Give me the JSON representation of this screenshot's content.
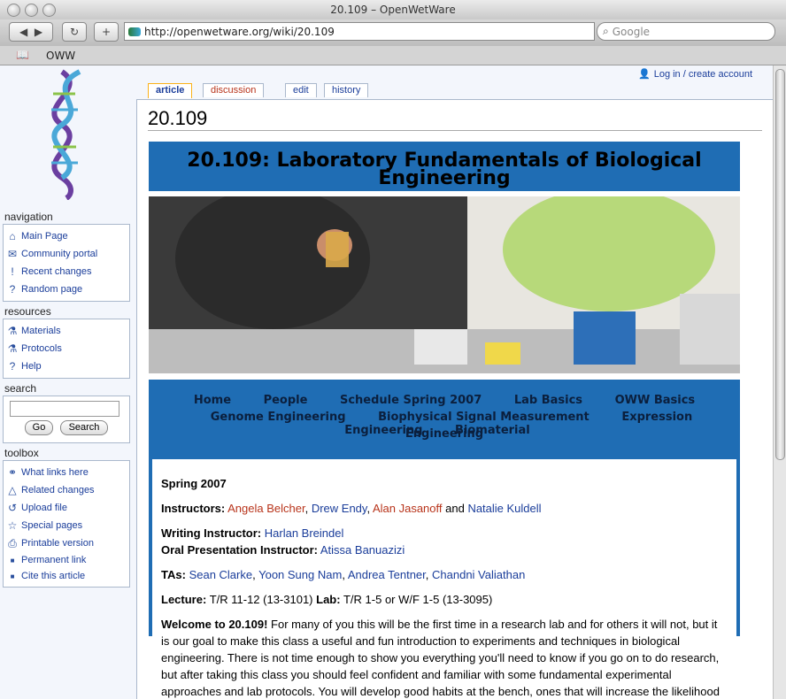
{
  "window": {
    "title": "20.109 – OpenWetWare"
  },
  "browser": {
    "url": "http://openwetware.org/wiki/20.109",
    "search_placeholder": "Google",
    "bookmarks": [
      "OWW"
    ]
  },
  "user_links": {
    "login": "Log in / create account"
  },
  "tabs": [
    "article",
    "discussion",
    "edit",
    "history"
  ],
  "sidebar": {
    "navigation_title": "navigation",
    "navigation": [
      {
        "label": "Main Page",
        "icon": "house-icon"
      },
      {
        "label": "Community portal",
        "icon": "chat-icon"
      },
      {
        "label": "Recent changes",
        "icon": "exclamation-icon"
      },
      {
        "label": "Random page",
        "icon": "question-icon"
      }
    ],
    "resources_title": "resources",
    "resources": [
      {
        "label": "Materials",
        "icon": "flask-icon"
      },
      {
        "label": "Protocols",
        "icon": "beaker-icon"
      },
      {
        "label": "Help",
        "icon": "question-icon"
      }
    ],
    "search_title": "search",
    "search_go": "Go",
    "search_button": "Search",
    "toolbox_title": "toolbox",
    "toolbox": [
      {
        "label": "What links here",
        "icon": "link-icon"
      },
      {
        "label": "Related changes",
        "icon": "triangle-icon"
      },
      {
        "label": "Upload file",
        "icon": "upload-icon"
      },
      {
        "label": "Special pages",
        "icon": "star-icon"
      },
      {
        "label": "Printable version",
        "icon": "printer-icon"
      },
      {
        "label": "Permanent link",
        "icon": "bullet"
      },
      {
        "label": "Cite this article",
        "icon": "bullet"
      }
    ]
  },
  "page": {
    "title": "20.109",
    "banner": "20.109: Laboratory Fundamentals of Biological Engineering",
    "nav_row1": [
      "Home",
      "People",
      "Schedule Spring 2007",
      "Lab Basics",
      "OWW Basics"
    ],
    "nav_row2": [
      "Genome Engineering",
      "Biophysical Signal Measurement",
      "Expression Engineering",
      "Biomaterial"
    ],
    "nav_row3": [
      "Engineering"
    ],
    "semester": "Spring 2007",
    "instructors_label": "Instructors:",
    "instructors": [
      "Angela Belcher",
      "Drew Endy",
      "Alan Jasanoff",
      "Natalie Kuldell"
    ],
    "writing_label": "Writing Instructor:",
    "writing_instructor": "Harlan Breindel",
    "oral_label": "Oral Presentation Instructor:",
    "oral_instructor": "Atissa Banuazizi",
    "tas_label": "TAs:",
    "tas": [
      "Sean Clarke",
      "Yoon Sung Nam",
      "Andrea Tentner",
      "Chandni Valiathan"
    ],
    "lecture_label": "Lecture:",
    "lecture": "T/R 11-12 (13-3101)",
    "lab_label": "Lab:",
    "lab": "T/R 1-5 or W/F 1-5 (13-3095)",
    "welcome_bold": "Welcome to 20.109!",
    "welcome_text": "For many of you this will be the first time in a research lab and for others it will not, but it is our goal to make this class a useful and fun introduction to experiments and techniques in biological engineering. There is not time enough to show you everything you'll need to know if you go on to do research, but after taking this class you should feel confident and familiar with some fundamental experimental approaches and lab protocols. You will develop good habits at the bench, ones that will increase the likelihood of success in your work and ensure the health and safety of you and those around you. By the end of the"
  }
}
